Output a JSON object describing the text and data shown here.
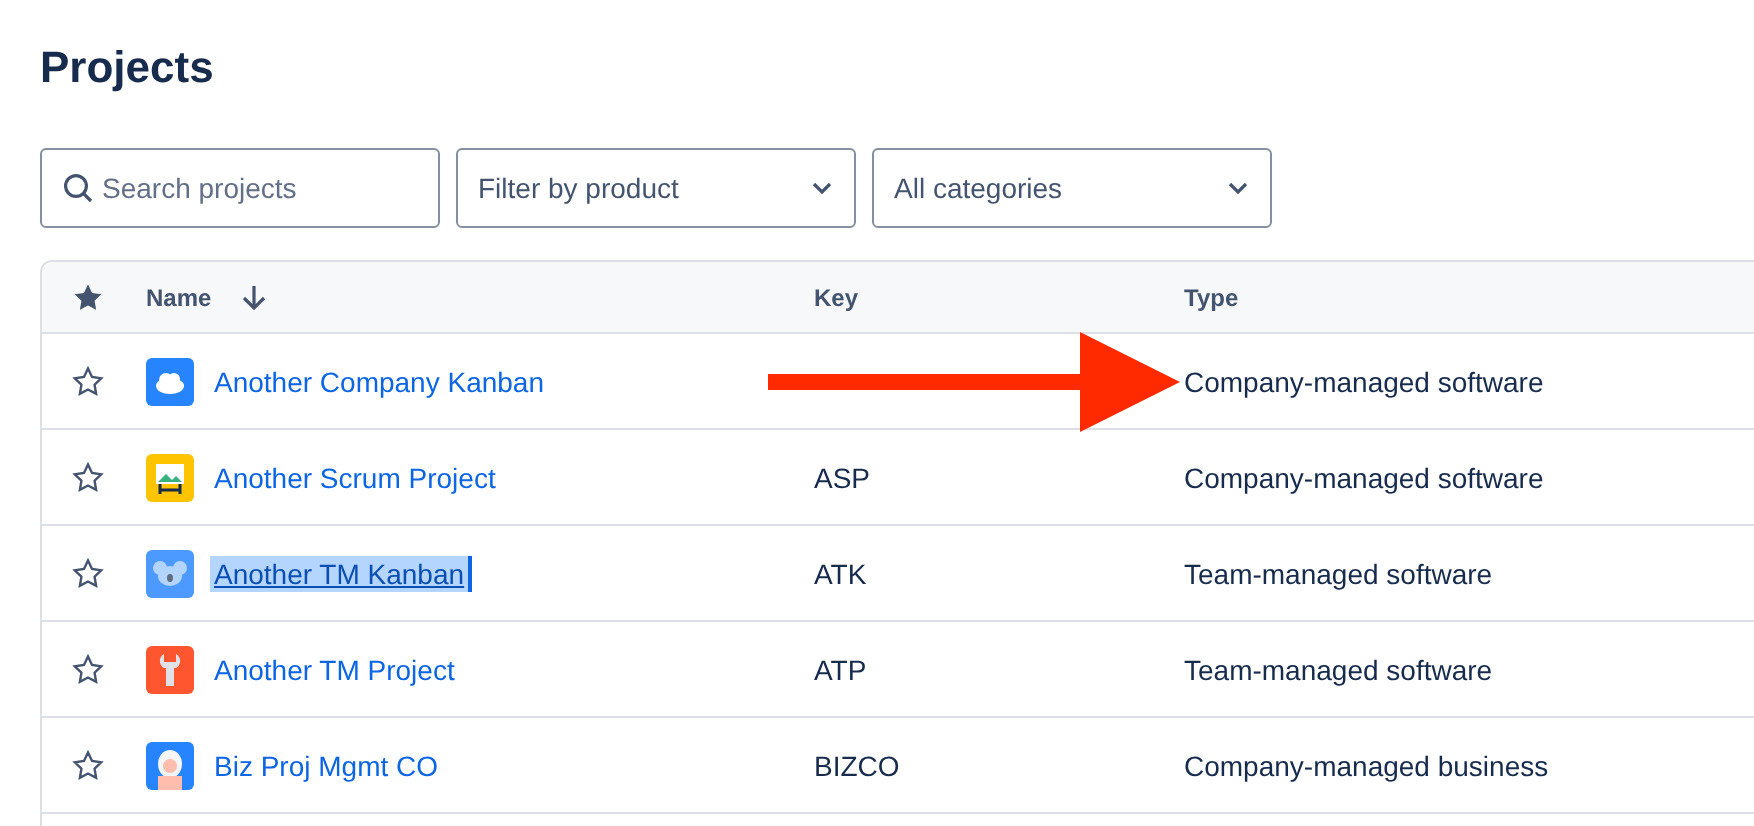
{
  "title": "Projects",
  "filters": {
    "search": {
      "placeholder": "Search projects"
    },
    "product": {
      "value": "Filter by product"
    },
    "category": {
      "value": "All categories"
    }
  },
  "table": {
    "columns": [
      {
        "kind": "star"
      },
      {
        "kind": "name",
        "label": "Name",
        "sorted": true
      },
      {
        "kind": "key",
        "label": "Key"
      },
      {
        "kind": "type",
        "label": "Type"
      }
    ],
    "rows": [
      {
        "name": "Another Company Kanban",
        "avatar": {
          "kind": "cloud",
          "color": "#2684ff"
        },
        "starred": false,
        "text_selected": false,
        "type": "Company-managed software"
      },
      {
        "name": "Another Scrum Project",
        "avatar": {
          "kind": "easel",
          "color": "#ffc400"
        },
        "starred": false,
        "text_selected": false,
        "key": "ASP",
        "type": "Company-managed software"
      },
      {
        "name": "Another TM Kanban",
        "avatar": {
          "kind": "koala",
          "color": "#4c9aff"
        },
        "starred": false,
        "text_selected": true,
        "key": "ATK",
        "type": "Team-managed software"
      },
      {
        "name": "Another TM Project",
        "avatar": {
          "kind": "wrench",
          "color": "#ff5630"
        },
        "starred": false,
        "text_selected": false,
        "key": "ATP",
        "type": "Team-managed software"
      },
      {
        "name": "Biz Proj Mgmt CO",
        "avatar": {
          "kind": "yeti",
          "color": "#2684ff"
        },
        "starred": false,
        "text_selected": false,
        "key": "BIZCO",
        "type": "Company-managed business"
      }
    ]
  },
  "annotation": {
    "kind": "arrow",
    "color": "#ff2a00"
  }
}
